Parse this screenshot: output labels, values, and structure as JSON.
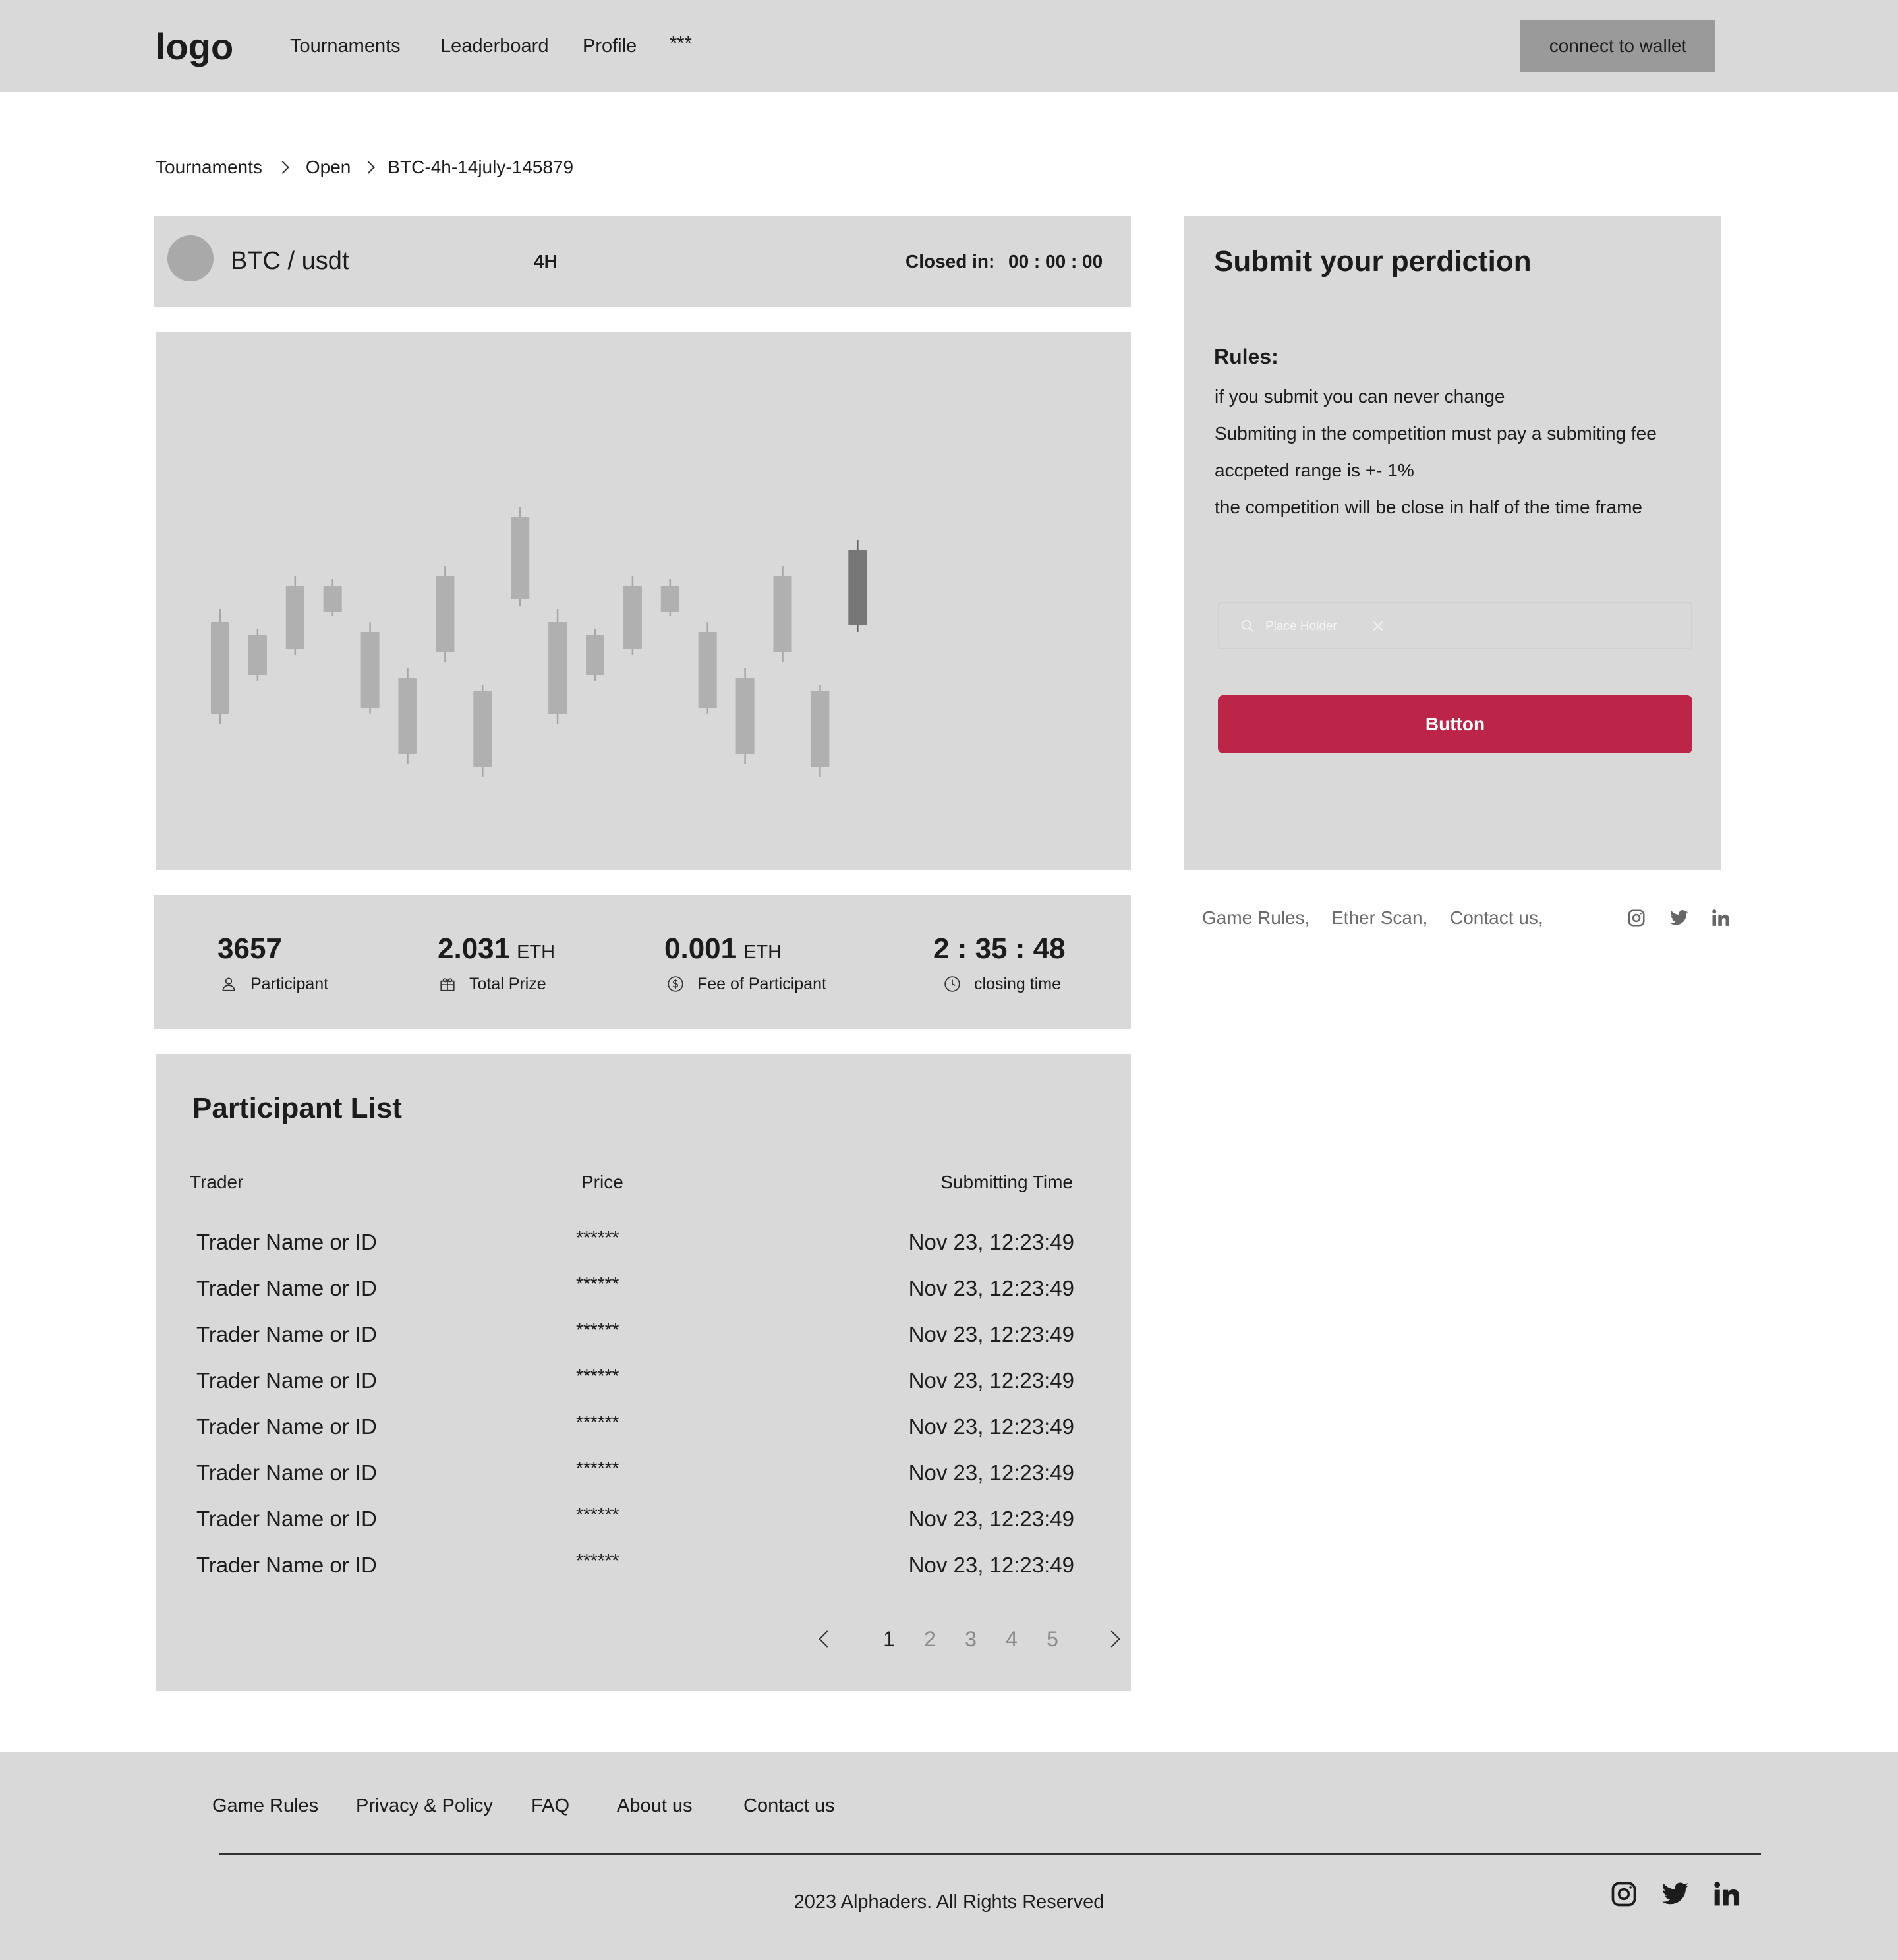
{
  "header": {
    "logo": "logo",
    "nav": [
      "Tournaments",
      "Leaderboard",
      "Profile",
      "***"
    ],
    "wallet_button": "connect to wallet"
  },
  "breadcrumb": [
    "Tournaments",
    "Open",
    "BTC-4h-14july-145879"
  ],
  "ticker": {
    "pair": "BTC / usdt",
    "timeframe": "4H",
    "closed_label": "Closed in:",
    "closed_value": "00 : 00 : 00"
  },
  "chart_data": {
    "type": "candlestick",
    "candles": [
      {
        "open": 18,
        "close": 46,
        "high": 50,
        "low": 15
      },
      {
        "open": 42,
        "close": 30,
        "high": 44,
        "low": 28
      },
      {
        "open": 38,
        "close": 57,
        "high": 60,
        "low": 36
      },
      {
        "open": 49,
        "close": 57,
        "high": 59,
        "low": 48
      },
      {
        "open": 20,
        "close": 43,
        "high": 46,
        "low": 18
      },
      {
        "open": 29,
        "close": 6,
        "high": 32,
        "low": 3
      },
      {
        "open": 37,
        "close": 60,
        "high": 63,
        "low": 34
      },
      {
        "open": 25,
        "close": 2,
        "high": 27,
        "low": -1
      },
      {
        "open": 53,
        "close": 78,
        "high": 81,
        "low": 51
      },
      {
        "open": 18,
        "close": 46,
        "high": 50,
        "low": 15
      },
      {
        "open": 42,
        "close": 30,
        "high": 44,
        "low": 28
      },
      {
        "open": 38,
        "close": 57,
        "high": 60,
        "low": 36
      },
      {
        "open": 49,
        "close": 57,
        "high": 59,
        "low": 48
      },
      {
        "open": 20,
        "close": 43,
        "high": 46,
        "low": 18
      },
      {
        "open": 29,
        "close": 6,
        "high": 32,
        "low": 3
      },
      {
        "open": 37,
        "close": 60,
        "high": 63,
        "low": 34
      },
      {
        "open": 25,
        "close": 2,
        "high": 27,
        "low": -1
      },
      {
        "open": 45,
        "close": 68,
        "high": 71,
        "low": 43
      }
    ],
    "ylim": [
      -10,
      90
    ],
    "grid": false,
    "colors": {
      "candle": "#b0b0b0",
      "wick": "#a6a6a6",
      "last_candle": "#777777",
      "last_wick": "#5e5e5e"
    }
  },
  "stats": [
    {
      "value": "3657",
      "unit": "",
      "label": "Participant",
      "icon": "user-icon"
    },
    {
      "value": "2.031",
      "unit": "ETH",
      "label": "Total Prize",
      "icon": "gift-icon"
    },
    {
      "value": "0.001",
      "unit": "ETH",
      "label": "Fee of Participant",
      "icon": "dollar-circle-icon"
    },
    {
      "value": "2 : 35 : 48",
      "unit": "",
      "label": "closing time",
      "icon": "clock-icon"
    }
  ],
  "participants": {
    "title": "Participant List",
    "columns": [
      "Trader",
      "Price",
      "Submitting Time"
    ],
    "rows": [
      {
        "name": "Trader Name or ID",
        "price": "******",
        "time": "Nov 23, 12:23:49"
      },
      {
        "name": "Trader Name or ID",
        "price": "******",
        "time": "Nov 23, 12:23:49"
      },
      {
        "name": "Trader Name or ID",
        "price": "******",
        "time": "Nov 23, 12:23:49"
      },
      {
        "name": "Trader Name or ID",
        "price": "******",
        "time": "Nov 23, 12:23:49"
      },
      {
        "name": "Trader Name or ID",
        "price": "******",
        "time": "Nov 23, 12:23:49"
      },
      {
        "name": "Trader Name or ID",
        "price": "******",
        "time": "Nov 23, 12:23:49"
      },
      {
        "name": "Trader Name or ID",
        "price": "******",
        "time": "Nov 23, 12:23:49"
      },
      {
        "name": "Trader Name or ID",
        "price": "******",
        "time": "Nov 23, 12:23:49"
      }
    ],
    "pages": [
      "1",
      "2",
      "3",
      "4",
      "5"
    ],
    "current_page": "1"
  },
  "prediction": {
    "title": "Submit your perdiction",
    "rules_title": "Rules:",
    "rules": [
      "if you submit you can never change",
      "Submiting in the competition must pay a submiting fee",
      "accpeted range is +- 1%",
      "the competition will be close in half of the time frame"
    ],
    "input_placeholder": "Place Holder",
    "button_label": "Button",
    "button_color": "#bc2448"
  },
  "side_links": [
    "Game Rules,",
    "Ether Scan,",
    "Contact us,"
  ],
  "social": [
    "instagram-icon",
    "twitter-icon",
    "linkedin-icon"
  ],
  "footer": {
    "links": [
      "Game Rules",
      "Privacy & Policy",
      "FAQ",
      "About us",
      "Contact us"
    ],
    "copyright": "2023 Alphaders. All Rights Reserved"
  }
}
